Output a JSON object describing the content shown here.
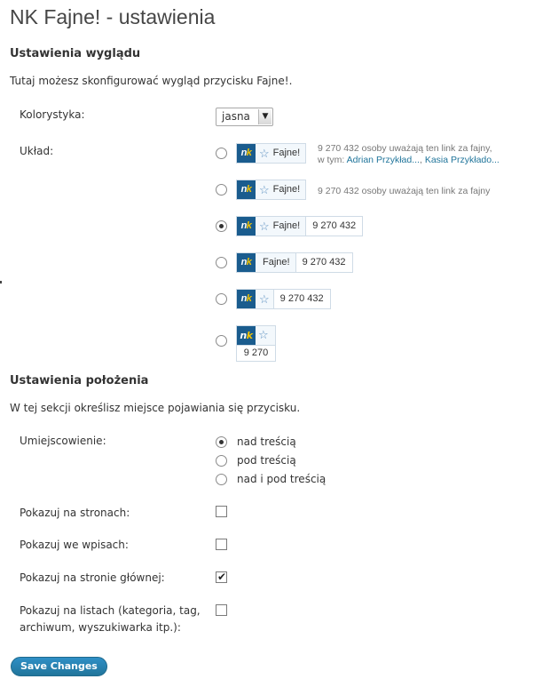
{
  "page": {
    "title": "NK Fajne! - ustawienia"
  },
  "appearance": {
    "heading": "Ustawienia wyglądu",
    "description": "Tutaj możesz skonfigurować wygląd przycisku Fajne!.",
    "color_scheme": {
      "label": "Kolorystyka:",
      "value": "jasna"
    },
    "layout_label": "Układ:",
    "button_text": "Fajne!",
    "count": "9 270 432",
    "vertical_count": "9 270",
    "layout_options": [
      {
        "checked": false,
        "desc_line1": "9 270 432 osoby uważają ten link za fajny,",
        "desc_prefix": "w tym: ",
        "link1": "Adrian Przykład...",
        "sep": ", ",
        "link2": "Kasia Przykłado..."
      },
      {
        "checked": false,
        "desc_line1": "9 270 432 osoby uważają ten link za fajny"
      },
      {
        "checked": true
      },
      {
        "checked": false
      },
      {
        "checked": false
      },
      {
        "checked": false
      }
    ]
  },
  "position": {
    "heading": "Ustawienia położenia",
    "description": "W tej sekcji określisz miejsce pojawiania się przycisku.",
    "placement": {
      "label": "Umiejscowienie:",
      "options": [
        {
          "label": "nad treścią",
          "checked": true
        },
        {
          "label": "pod treścią",
          "checked": false
        },
        {
          "label": "nad i pod treścią",
          "checked": false
        }
      ]
    },
    "show_on_pages": {
      "label": "Pokazuj na stronach:",
      "checked": false
    },
    "show_in_posts": {
      "label": "Pokazuj we wpisach:",
      "checked": false
    },
    "show_on_home": {
      "label": "Pokazuj na stronie głównej:",
      "checked": true
    },
    "show_on_lists": {
      "label_line1": "Pokazuj na listach (kategoria, tag,",
      "label_line2": "archiwum, wyszukiwarka itp.):",
      "checked": false
    }
  },
  "actions": {
    "save_label": "Save Changes"
  },
  "icons": {
    "star": "star-icon",
    "logo": "nk-logo",
    "tick": "checkmark-icon",
    "dropdown": "chevron-down-icon"
  },
  "colors": {
    "nk_blue": "#1a5c8e",
    "nk_yellow": "#f5c400",
    "link": "#21759b",
    "button": "#21759b"
  }
}
